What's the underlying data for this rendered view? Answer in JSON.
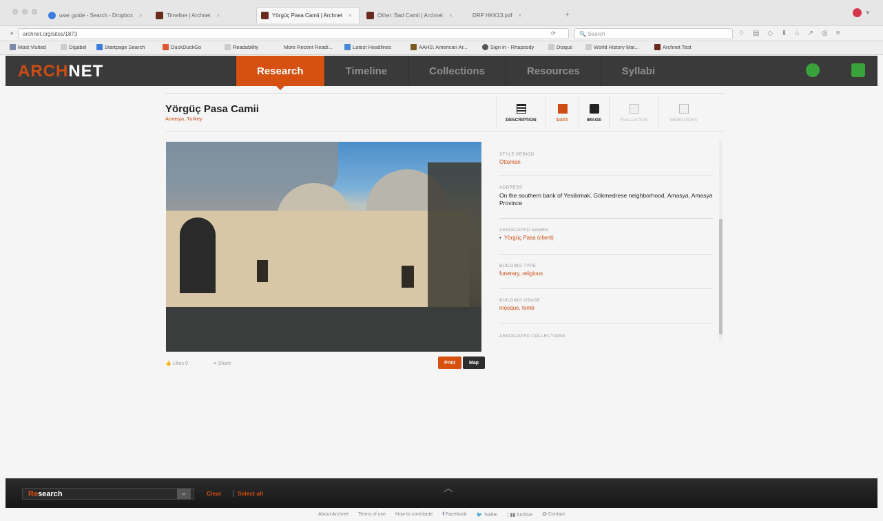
{
  "browser": {
    "tabs": [
      {
        "label": "user guide - Search - Dropbox"
      },
      {
        "label": "Timeline | Archnet"
      },
      {
        "label": "Yörgüç Pasa Camii | Archnet"
      },
      {
        "label": "Other: Bad Camii | Archnet"
      },
      {
        "label": "DRP HKK13.pdf"
      }
    ],
    "url": "archnet.org/sites/1873",
    "search_placeholder": "Search",
    "bookmarks": [
      "Most Visited",
      "Digabel",
      "Startpage Search",
      "DuckDuckGo",
      "Readability",
      "More Recent Readi...",
      "Latest Headlines",
      "AAHS: American Ar...",
      "Sign in - Rhapsody",
      "Disqus",
      "World History Mar...",
      "Archnet Test"
    ]
  },
  "site": {
    "logo_part1": "ARCH",
    "logo_part2": "NET",
    "nav": [
      "Research",
      "Timeline",
      "Collections",
      "Resources",
      "Syllabi"
    ]
  },
  "page": {
    "title": "Yörgüç Pasa Camii",
    "location": "Amasya, Turkey",
    "tabs": [
      "DESCRIPTION",
      "DATA",
      "IMAGE",
      "EVALUATION",
      "WEBGUIDES"
    ]
  },
  "details": {
    "style_period_label": "STYLE PERIOD",
    "style_period": "Ottoman",
    "address_label": "ADDRESS",
    "address": "On the southern bank of Yesilirmak, Gökmedrese neighborhood, Amasya, Amasya Province",
    "associated_names_label": "ASSOCIATED NAMES",
    "associated_names": [
      "Yörgüç Pasa (client)"
    ],
    "building_type_label": "BUILDING TYPE",
    "building_type": "funerary, religious",
    "building_usage_label": "BUILDING USAGE",
    "building_usage": "mosque, tomb",
    "associated_collections_label": "ASSOCIATED COLLECTIONS"
  },
  "actions": {
    "likes": "Likes 0",
    "share": "Share",
    "print": "Print",
    "map": "Map"
  },
  "research_bar": {
    "prefix": "Re",
    "rest": "search",
    "clear": "Clear",
    "select_all": "Select all"
  },
  "footer": {
    "links": [
      "About Archnet",
      "Terms of use",
      "How to contribute",
      "Facebook",
      "Twitter",
      "Archive",
      "Contact"
    ]
  },
  "colors": {
    "accent": "#d6500f",
    "header_bg": "#3a3a3a",
    "icon_green": "#3aa23a"
  }
}
